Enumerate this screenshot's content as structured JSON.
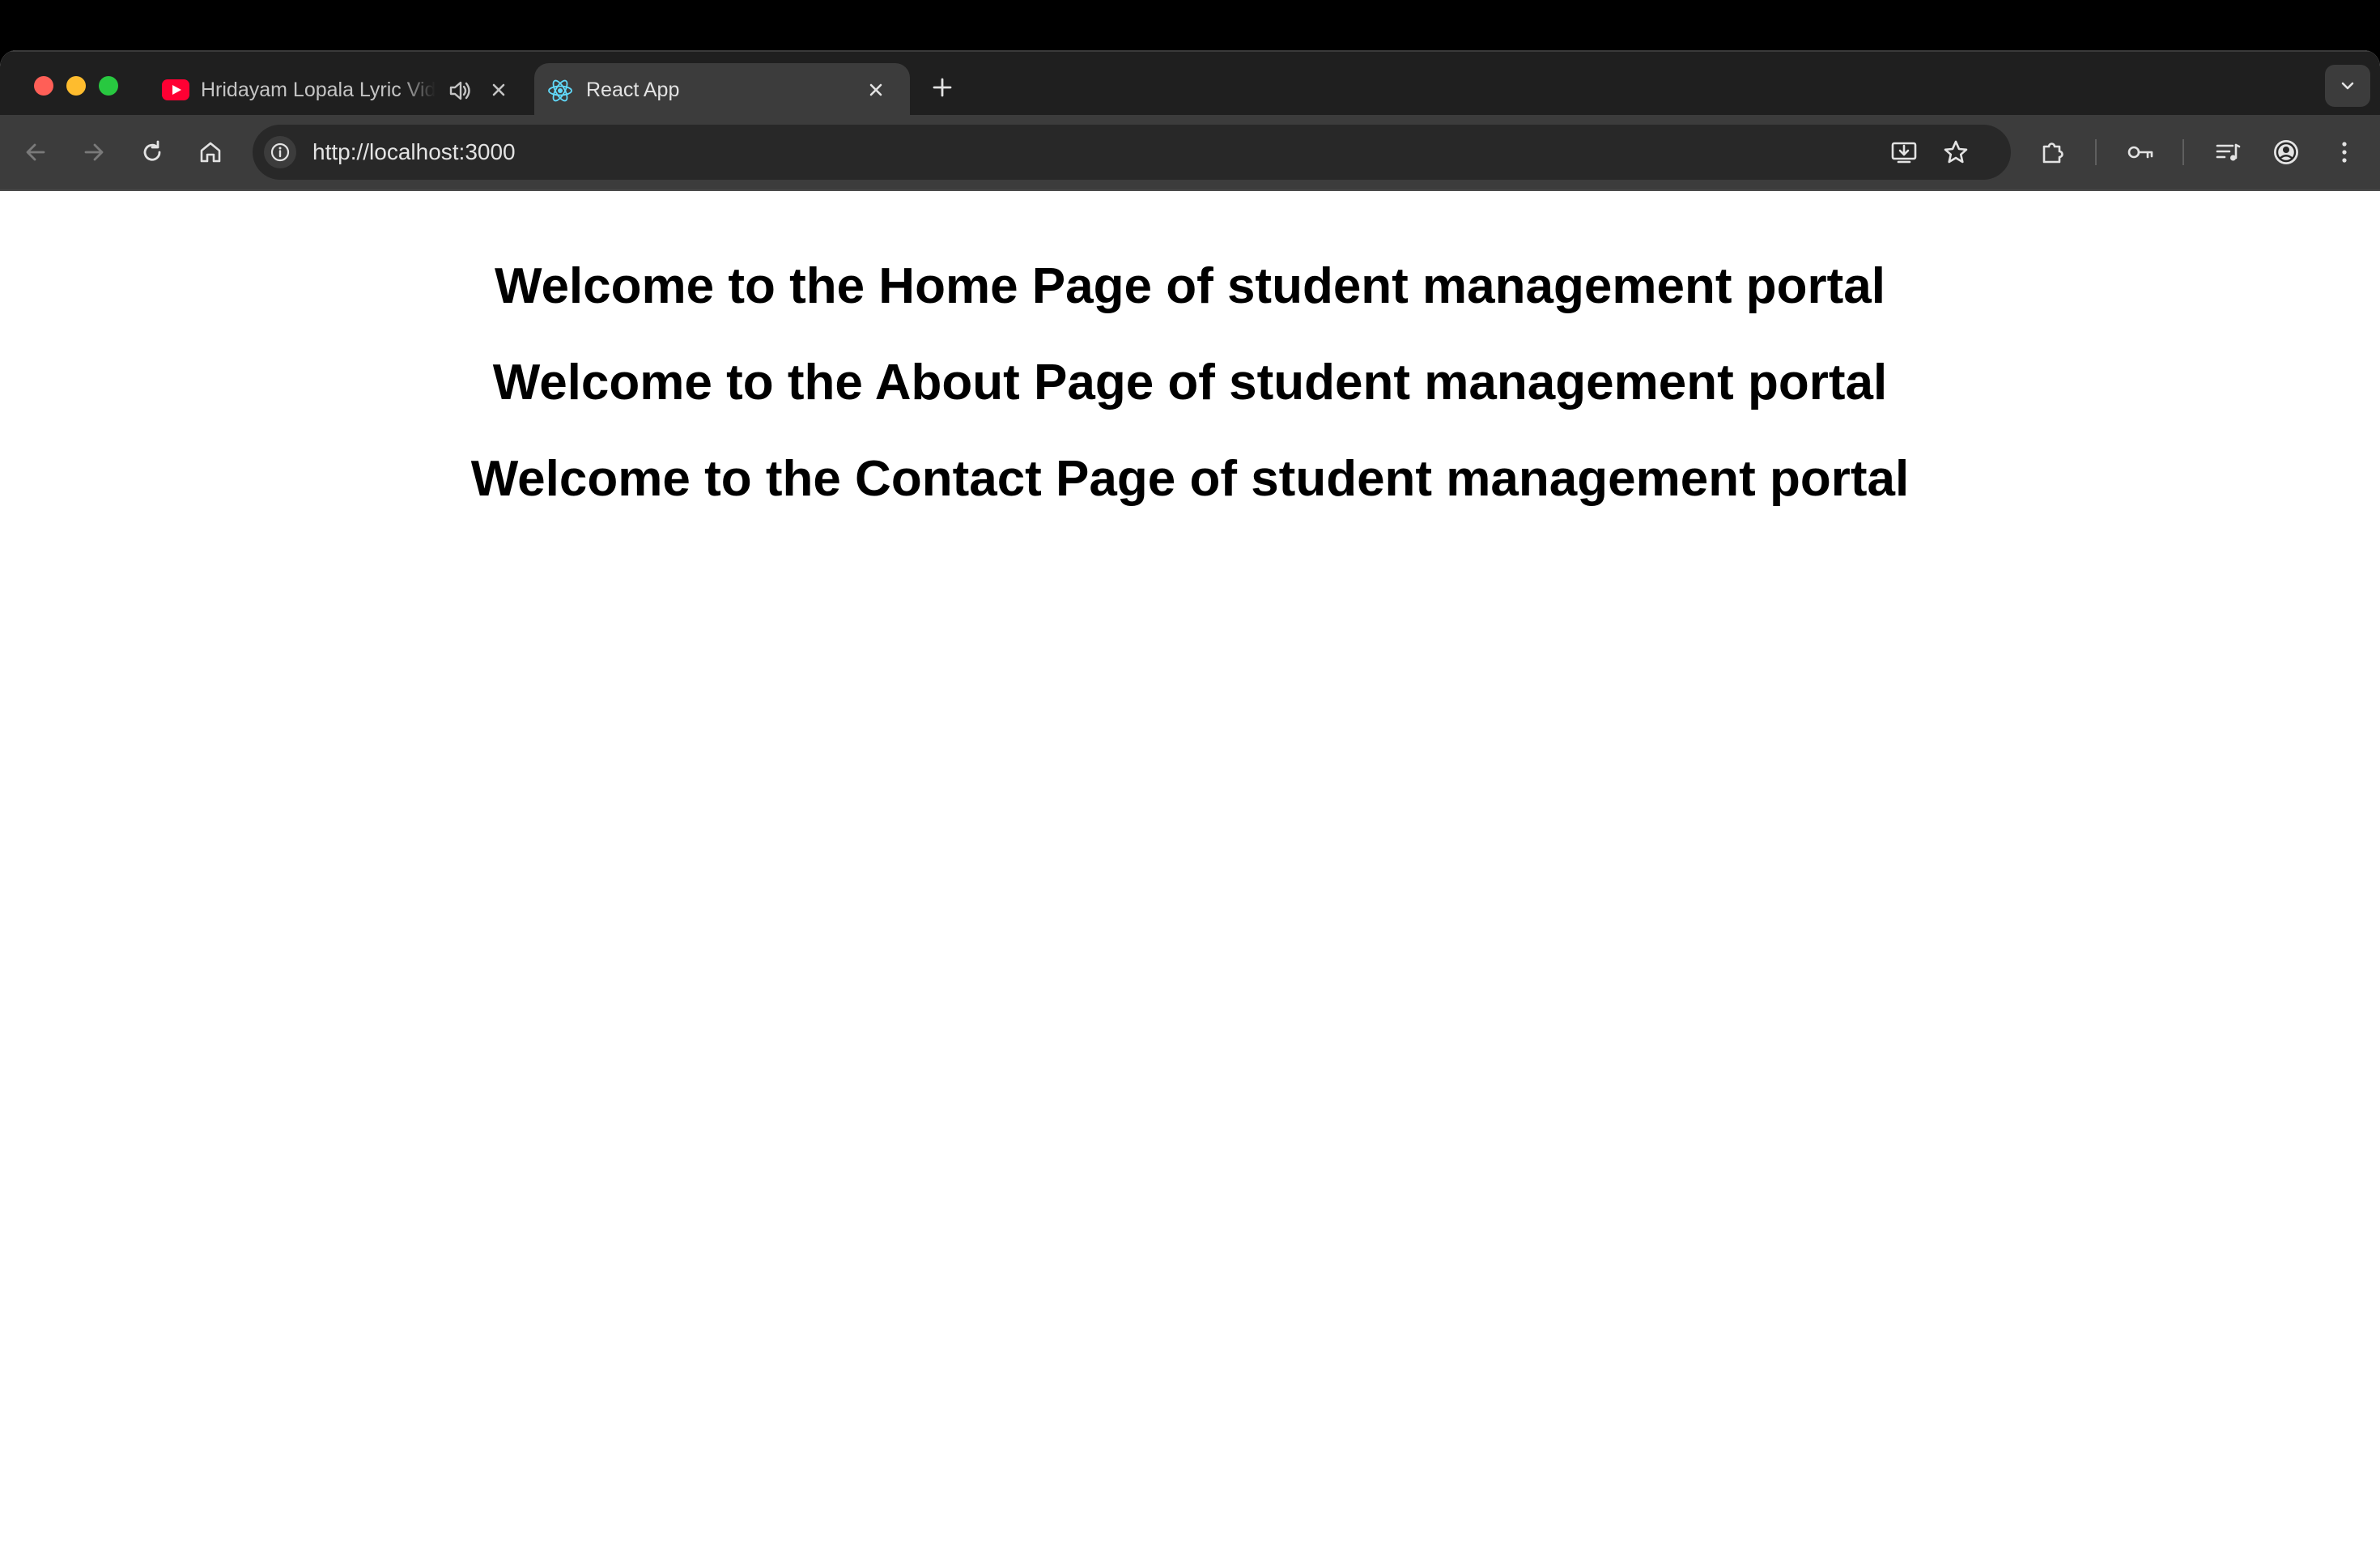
{
  "browser": {
    "tabs": [
      {
        "title": "Hridayam Lopala Lyric Video",
        "favicon": "youtube-icon",
        "audio_playing": true,
        "active": false
      },
      {
        "title": "React App",
        "favicon": "react-icon",
        "active": true
      }
    ],
    "address_bar": {
      "url": "http://localhost:3000"
    },
    "colors": {
      "tabstrip": "#1f1f1f",
      "toolbar": "#3c3c3c",
      "omnibox": "#282828",
      "text": "#e3e3e3"
    }
  },
  "page": {
    "headings": [
      "Welcome to the Home Page of student management portal",
      "Welcome to the About Page of student management portal",
      "Welcome to the Contact Page of student management portal"
    ]
  }
}
